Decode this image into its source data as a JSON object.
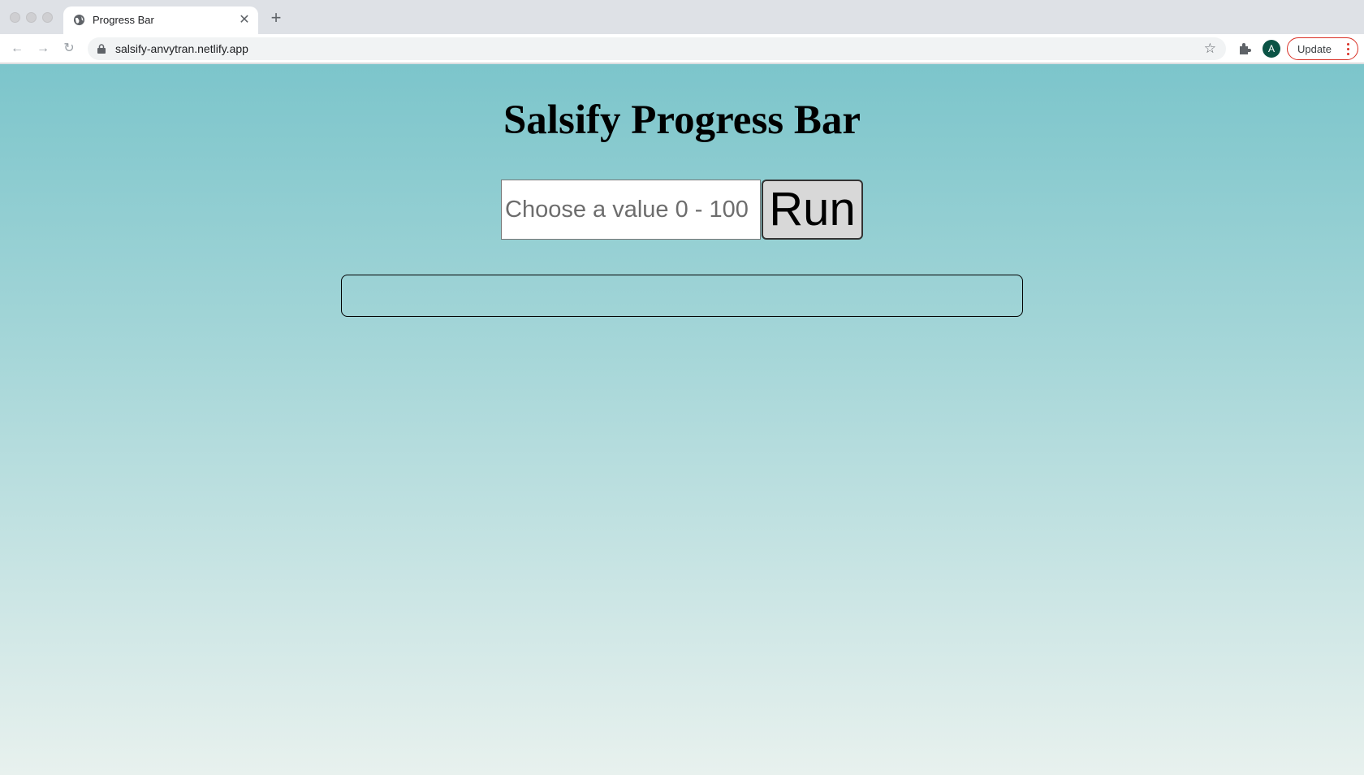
{
  "browser": {
    "tab_title": "Progress Bar",
    "tab_close": "✕",
    "new_tab": "+",
    "back": "←",
    "forward": "→",
    "reload": "↻",
    "url": "salsify-anvytran.netlify.app",
    "star": "☆",
    "avatar_letter": "A",
    "update_label": "Update"
  },
  "app": {
    "title": "Salsify Progress Bar",
    "value_input": {
      "placeholder": "Choose a value 0 - 100",
      "value": ""
    },
    "run_label": "Run",
    "progress_value": 0,
    "accent_color": "#4a9aa0"
  }
}
